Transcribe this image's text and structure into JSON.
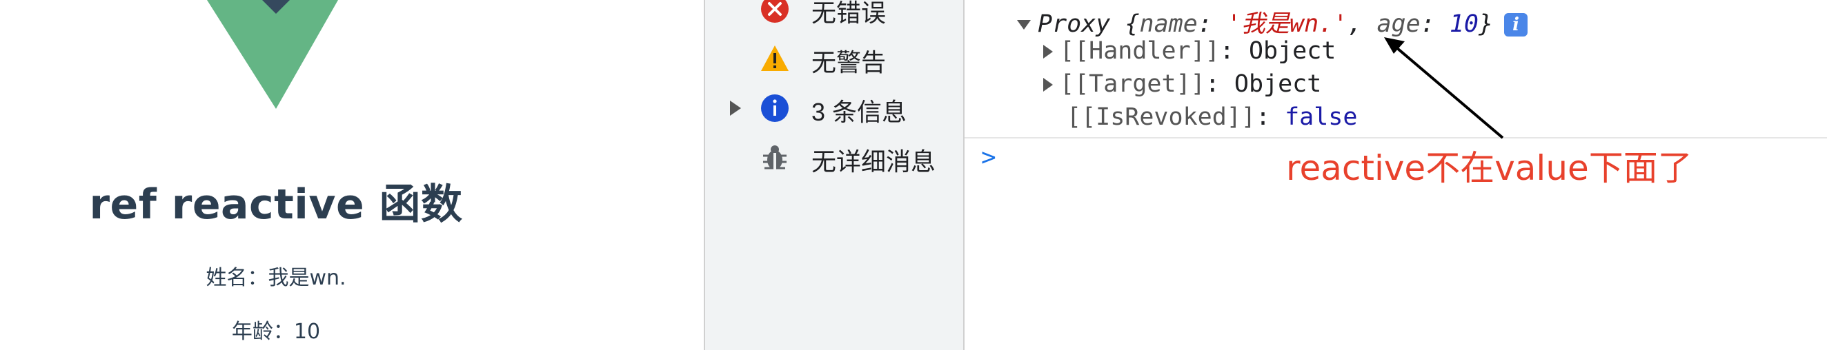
{
  "app": {
    "title": "ref reactive 函数",
    "name_line": "姓名：我是wn.",
    "age_line": "年龄：10",
    "logo_colors": {
      "outer": "#42b883",
      "inner": "#35495e"
    }
  },
  "sidebar": {
    "items": [
      {
        "label": "无错误",
        "icon": "error-icon",
        "color": "#d93025"
      },
      {
        "label": "无警告",
        "icon": "warning-icon",
        "color": "#f9ab00"
      },
      {
        "label": "3 条信息",
        "icon": "info-icon",
        "color": "#1a73e8"
      },
      {
        "label": "无详细消息",
        "icon": "bug-icon",
        "color": "#5f6368"
      }
    ]
  },
  "console": {
    "proxy_line": {
      "type": "Proxy",
      "open": "{",
      "key1": "name",
      "val1": "'我是wn.'",
      "key2": "age",
      "val2": "10",
      "close": "}",
      "badge": "i"
    },
    "handler": "[[Handler]]",
    "handler_val": "Object",
    "target": "[[Target]]",
    "target_val": "Object",
    "revoked": "[[IsRevoked]]",
    "revoked_val": "false",
    "prompt": ">"
  },
  "annotation": "reactive不在value下面了"
}
